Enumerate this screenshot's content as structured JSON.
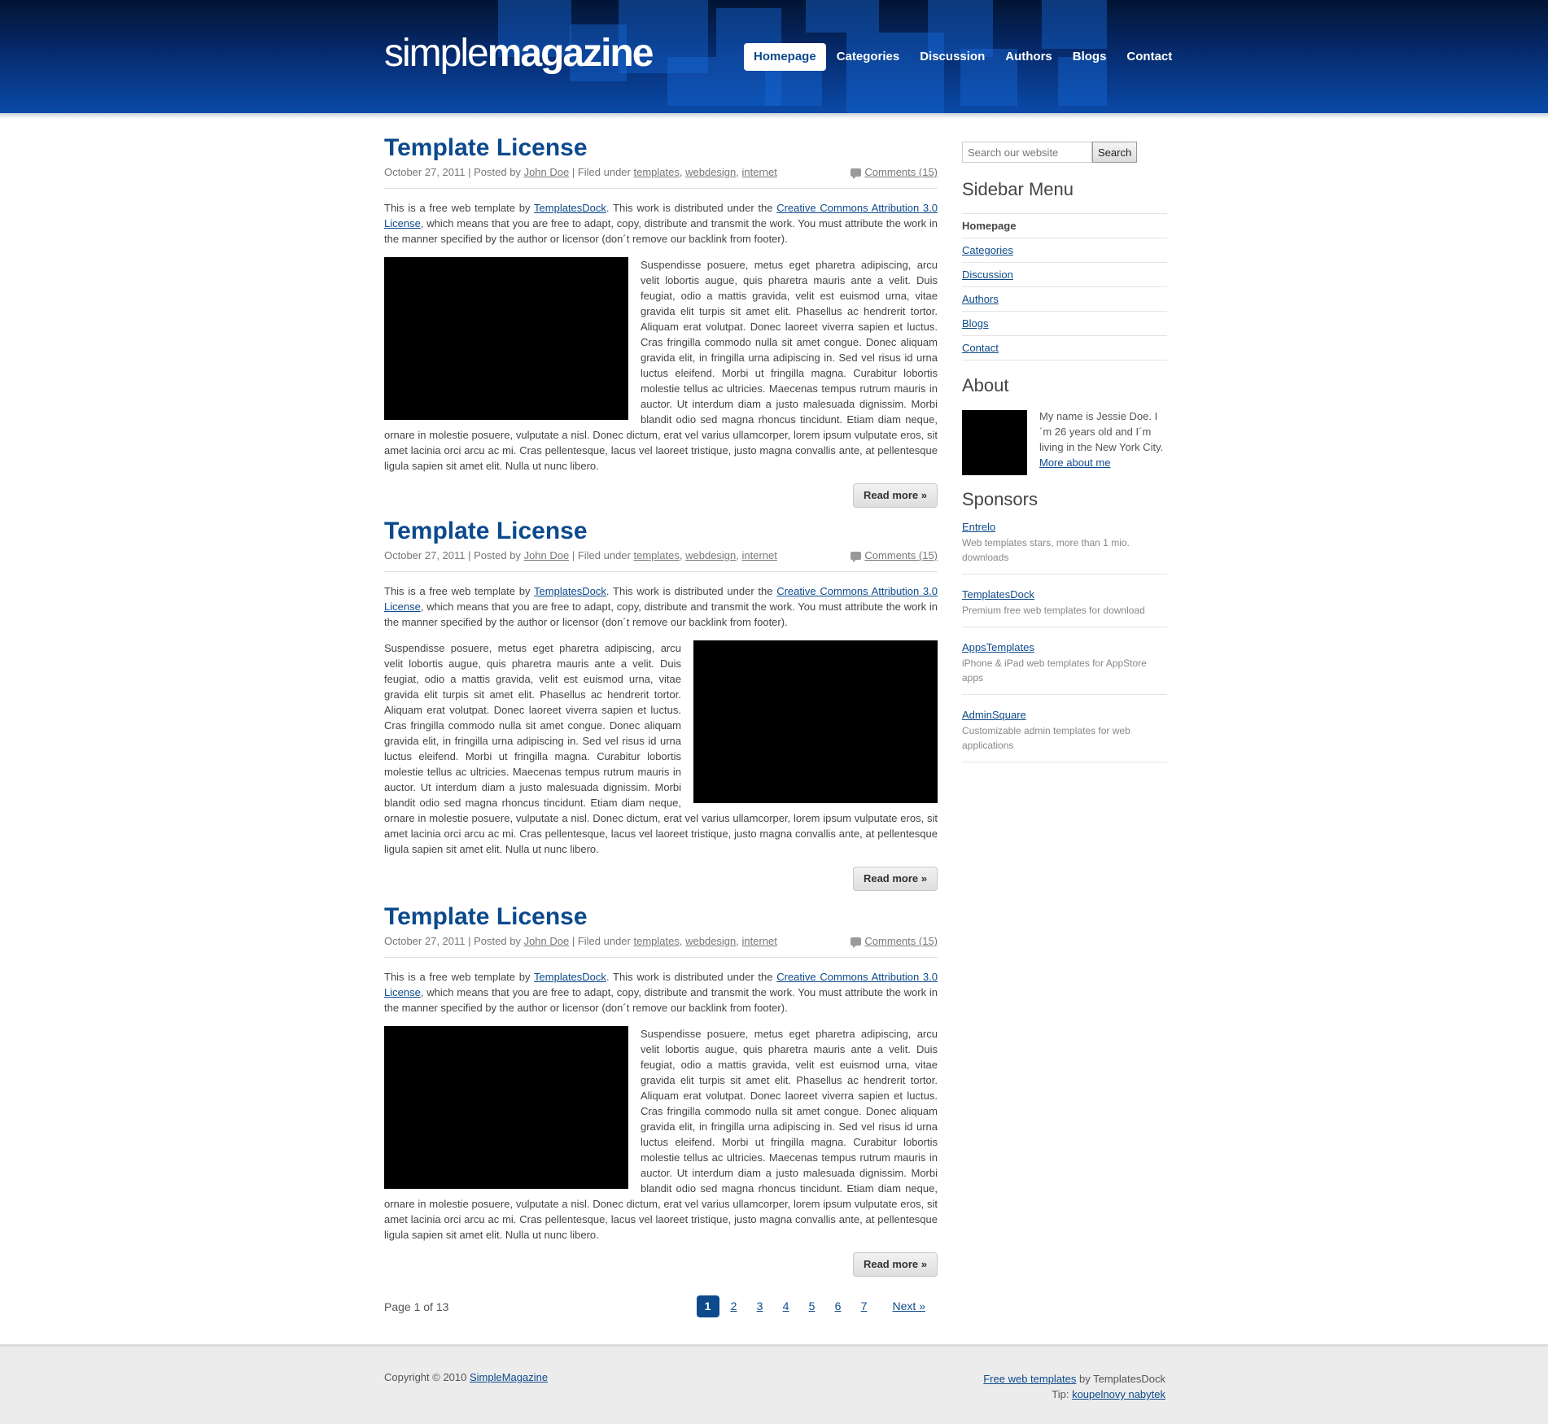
{
  "header": {
    "logo_light": "simple",
    "logo_bold": "magazine",
    "nav": [
      {
        "label": "Homepage",
        "active": true
      },
      {
        "label": "Categories"
      },
      {
        "label": "Discussion"
      },
      {
        "label": "Authors"
      },
      {
        "label": "Blogs"
      },
      {
        "label": "Contact"
      }
    ]
  },
  "posts": [
    {
      "title": "Template License",
      "date": "October 27, 2011",
      "posted_by_prefix": "| Posted by",
      "author": "John Doe",
      "filed_prefix": "| Filed under",
      "tags": [
        "templates",
        "webdesign",
        "internet"
      ],
      "comments": "Comments (15)",
      "intro_1": "This is a free web template by ",
      "intro_link_1": "TemplatesDock",
      "intro_2": ". This work is distributed under the ",
      "intro_link_2": "Creative Commons Attribution 3.0 License",
      "intro_3": ", which means that you are free to adapt, copy, distribute and transmit the work. You must attribute the work in the manner specified by the author or licensor (don´t remove our backlink from footer).",
      "body": "Suspendisse posuere, metus eget pharetra adipiscing, arcu velit lobortis augue, quis pharetra mauris ante a velit. Duis feugiat, odio a mattis gravida, velit est euismod urna, vitae gravida elit turpis sit amet elit. Phasellus ac hendrerit tortor. Aliquam erat volutpat. Donec laoreet viverra sapien et luctus. Cras fringilla commodo nulla sit amet congue. Donec aliquam gravida elit, in fringilla urna adipiscing in. Sed vel risus id urna luctus eleifend. Morbi ut fringilla magna. Curabitur lobortis molestie tellus ac ultricies. Maecenas tempus rutrum mauris in auctor. Ut interdum diam a justo malesuada dignissim. Morbi blandit odio sed magna rhoncus tincidunt. Etiam diam neque, ornare in molestie posuere, vulputate a nisl. Donec dictum, erat vel varius ullamcorper, lorem ipsum vulputate eros, sit amet lacinia orci arcu ac mi. Cras pellentesque, lacus vel laoreet tristique, justo magna convallis ante, at pellentesque ligula sapien sit amet elit. Nulla ut nunc libero.",
      "read_more": "Read more »"
    },
    {
      "title": "Template License",
      "date": "October 27, 2011",
      "posted_by_prefix": "| Posted by",
      "author": "John Doe",
      "filed_prefix": "| Filed under",
      "tags": [
        "templates",
        "webdesign",
        "internet"
      ],
      "comments": "Comments (15)",
      "intro_1": "This is a free web template by ",
      "intro_link_1": "TemplatesDock",
      "intro_2": ". This work is distributed under the ",
      "intro_link_2": "Creative Commons Attribution 3.0 License",
      "intro_3": ", which means that you are free to adapt, copy, distribute and transmit the work. You must attribute the work in the manner specified by the author or licensor (don´t remove our backlink from footer).",
      "body": "Suspendisse posuere, metus eget pharetra adipiscing, arcu velit lobortis augue, quis pharetra mauris ante a velit. Duis feugiat, odio a mattis gravida, velit est euismod urna, vitae gravida elit turpis sit amet elit. Phasellus ac hendrerit tortor. Aliquam erat volutpat. Donec laoreet viverra sapien et luctus. Cras fringilla commodo nulla sit amet congue. Donec aliquam gravida elit, in fringilla urna adipiscing in. Sed vel risus id urna luctus eleifend. Morbi ut fringilla magna. Curabitur lobortis molestie tellus ac ultricies. Maecenas tempus rutrum mauris in auctor. Ut interdum diam a justo malesuada dignissim. Morbi blandit odio sed magna rhoncus tincidunt. Etiam diam neque, ornare in molestie posuere, vulputate a nisl. Donec dictum, erat vel varius ullamcorper, lorem ipsum vulputate eros, sit amet lacinia orci arcu ac mi. Cras pellentesque, lacus vel laoreet tristique, justo magna convallis ante, at pellentesque ligula sapien sit amet elit. Nulla ut nunc libero.",
      "read_more": "Read more »"
    },
    {
      "title": "Template License",
      "date": "October 27, 2011",
      "posted_by_prefix": "| Posted by",
      "author": "John Doe",
      "filed_prefix": "| Filed under",
      "tags": [
        "templates",
        "webdesign",
        "internet"
      ],
      "comments": "Comments (15)",
      "intro_1": "This is a free web template by ",
      "intro_link_1": "TemplatesDock",
      "intro_2": ". This work is distributed under the ",
      "intro_link_2": "Creative Commons Attribution 3.0 License",
      "intro_3": ", which means that you are free to adapt, copy, distribute and transmit the work. You must attribute the work in the manner specified by the author or licensor (don´t remove our backlink from footer).",
      "body": "Suspendisse posuere, metus eget pharetra adipiscing, arcu velit lobortis augue, quis pharetra mauris ante a velit. Duis feugiat, odio a mattis gravida, velit est euismod urna, vitae gravida elit turpis sit amet elit. Phasellus ac hendrerit tortor. Aliquam erat volutpat. Donec laoreet viverra sapien et luctus. Cras fringilla commodo nulla sit amet congue. Donec aliquam gravida elit, in fringilla urna adipiscing in. Sed vel risus id urna luctus eleifend. Morbi ut fringilla magna. Curabitur lobortis molestie tellus ac ultricies. Maecenas tempus rutrum mauris in auctor. Ut interdum diam a justo malesuada dignissim. Morbi blandit odio sed magna rhoncus tincidunt. Etiam diam neque, ornare in molestie posuere, vulputate a nisl. Donec dictum, erat vel varius ullamcorper, lorem ipsum vulputate eros, sit amet lacinia orci arcu ac mi. Cras pellentesque, lacus vel laoreet tristique, justo magna convallis ante, at pellentesque ligula sapien sit amet elit. Nulla ut nunc libero.",
      "read_more": "Read more »"
    }
  ],
  "pagination": {
    "info": "Page 1 of 13",
    "pages": [
      "1",
      "2",
      "3",
      "4",
      "5",
      "6",
      "7"
    ],
    "current": "1",
    "next": "Next »"
  },
  "sidebar": {
    "search_placeholder": "Search our website",
    "search_button": "Search",
    "menu_title": "Sidebar Menu",
    "menu": [
      {
        "label": "Homepage",
        "active": true
      },
      {
        "label": "Categories"
      },
      {
        "label": "Discussion"
      },
      {
        "label": "Authors"
      },
      {
        "label": "Blogs"
      },
      {
        "label": "Contact"
      }
    ],
    "about_title": "About",
    "about_text": "My name is Jessie Doe. I´m 26 years old and I´m living in the New York City.",
    "about_link": "More about me",
    "sponsors_title": "Sponsors",
    "sponsors": [
      {
        "name": "Entrelo",
        "desc": "Web templates stars, more than 1 mio. downloads"
      },
      {
        "name": "TemplatesDock",
        "desc": "Premium free web templates for download"
      },
      {
        "name": "AppsTemplates",
        "desc": "iPhone & iPad web templates for AppStore apps"
      },
      {
        "name": "AdminSquare",
        "desc": "Customizable admin templates for web applications"
      }
    ]
  },
  "footer": {
    "copyright": "Copyright © 2010 ",
    "copyright_link": "SimpleMagazine",
    "right_link": "Free web templates",
    "right_text": " by TemplatesDock",
    "tip_label": "Tip: ",
    "tip_link": "koupelnovy nabytek"
  },
  "colors": {
    "brand_blue": "#0c4a8e",
    "header_dark": "#021433",
    "header_light": "#0a4aa8"
  }
}
